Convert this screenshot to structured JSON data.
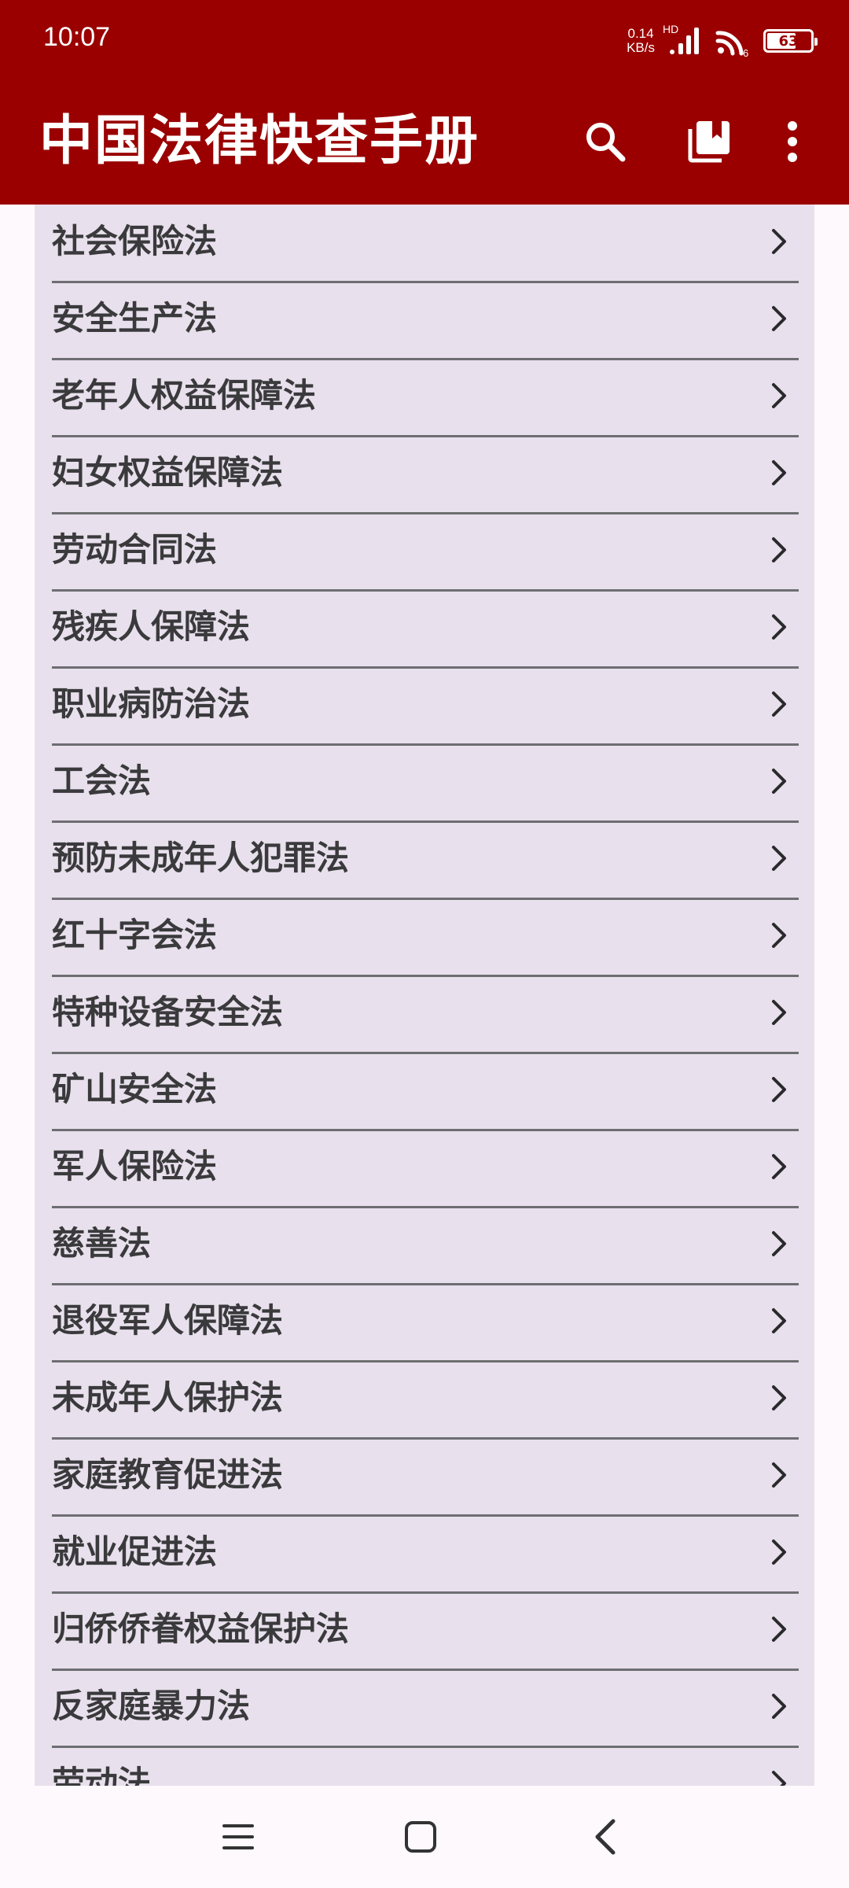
{
  "status_bar": {
    "time": "10:07",
    "net_speed_value": "0.14",
    "net_speed_unit": "KB/s",
    "network_label": "HD",
    "battery_level": "63"
  },
  "app_bar": {
    "title": "中国法律快查手册"
  },
  "law_list": [
    "社会保险法",
    "安全生产法",
    "老年人权益保障法",
    "妇女权益保障法",
    "劳动合同法",
    "残疾人保障法",
    "职业病防治法",
    "工会法",
    "预防未成年人犯罪法",
    "红十字会法",
    "特种设备安全法",
    "矿山安全法",
    "军人保险法",
    "慈善法",
    "退役军人保障法",
    "未成年人保护法",
    "家庭教育促进法",
    "就业促进法",
    "归侨侨眷权益保护法",
    "反家庭暴力法",
    "劳动法"
  ],
  "colors": {
    "primary": "#9A0000",
    "list_background": "#E8E0EC",
    "divider": "#6E6E72",
    "text": "#3A3A3C",
    "page_background": "#FDF9FD"
  }
}
